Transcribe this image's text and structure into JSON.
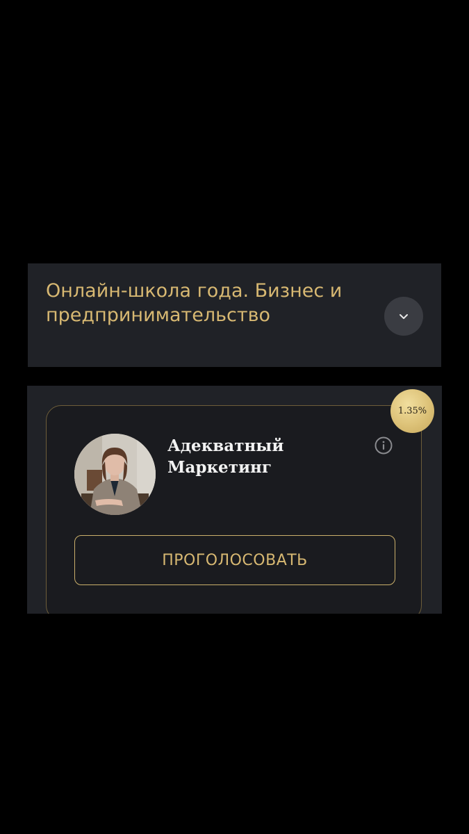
{
  "category": {
    "title": "Онлайн-школа года. Бизнес и предпринимательство",
    "expand_icon": "chevron-down-icon"
  },
  "nominee": {
    "name": "Адекватный Маркетинг",
    "vote_label": "ПРОГОЛОСОВАТЬ",
    "percent": "1.35%",
    "info_icon": "info-icon"
  },
  "colors": {
    "background": "#000000",
    "panel": "#202227",
    "card": "#1a1b1f",
    "gold": "#d7b872",
    "badge": "#dcc177"
  }
}
